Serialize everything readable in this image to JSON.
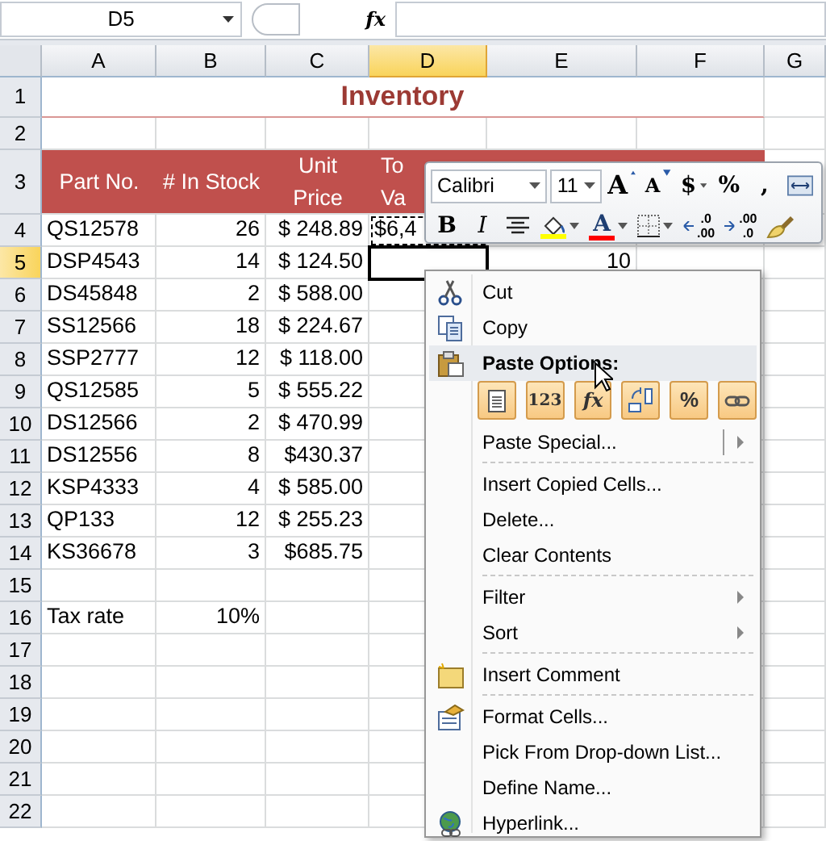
{
  "name_box": {
    "value": "D5"
  },
  "formula_bar": {
    "fx_label": "fx"
  },
  "columns": [
    {
      "label": "A",
      "selected": false
    },
    {
      "label": "B",
      "selected": false
    },
    {
      "label": "C",
      "selected": false
    },
    {
      "label": "D",
      "selected": true
    },
    {
      "label": "E",
      "selected": false
    },
    {
      "label": "F",
      "selected": false
    },
    {
      "label": "G",
      "selected": false
    }
  ],
  "rows": [
    {
      "number": "1",
      "selected": false,
      "kind": "title",
      "title": "Inventory"
    },
    {
      "number": "2",
      "selected": false,
      "kind": "blank"
    },
    {
      "number": "3",
      "selected": false,
      "kind": "header",
      "headers": [
        {
          "kind": "full",
          "lines": [
            "Part No."
          ]
        },
        {
          "kind": "full",
          "lines": [
            "# In Stock"
          ]
        },
        {
          "kind": "full",
          "lines": [
            "Unit",
            "Price"
          ]
        },
        {
          "kind": "clipped",
          "lines": [
            "To",
            "Va"
          ]
        }
      ]
    },
    {
      "number": "4",
      "selected": false,
      "kind": "data",
      "cells": [
        {
          "text": "QS12578"
        },
        {
          "text": "26"
        },
        {
          "text": "$ 248.89"
        },
        {
          "kind": "clipped",
          "text": "$6,4",
          "copied": true
        },
        null,
        null,
        null
      ]
    },
    {
      "number": "5",
      "selected": true,
      "kind": "data",
      "cells": [
        {
          "text": "DSP4543"
        },
        {
          "text": "14"
        },
        {
          "text": "$ 124.50"
        },
        {
          "active": true
        },
        {
          "text": "10"
        },
        null,
        null
      ]
    },
    {
      "number": "6",
      "selected": false,
      "kind": "data",
      "cells": [
        {
          "text": "DS45848"
        },
        {
          "text": "2"
        },
        {
          "text": "$ 588.00"
        },
        null,
        null,
        null,
        null
      ]
    },
    {
      "number": "7",
      "selected": false,
      "kind": "data",
      "cells": [
        {
          "text": "SS12566"
        },
        {
          "text": "18"
        },
        {
          "text": "$ 224.67"
        },
        null,
        null,
        null,
        null
      ]
    },
    {
      "number": "8",
      "selected": false,
      "kind": "data",
      "cells": [
        {
          "text": "SSP2777"
        },
        {
          "text": "12"
        },
        {
          "text": "$ 118.00"
        },
        null,
        null,
        null,
        null
      ]
    },
    {
      "number": "9",
      "selected": false,
      "kind": "data",
      "cells": [
        {
          "text": "QS12585"
        },
        {
          "text": "5"
        },
        {
          "text": "$ 555.22"
        },
        null,
        null,
        null,
        null
      ]
    },
    {
      "number": "10",
      "selected": false,
      "kind": "data",
      "cells": [
        {
          "text": "DS12566"
        },
        {
          "text": "2"
        },
        {
          "text": "$ 470.99"
        },
        null,
        null,
        null,
        null
      ]
    },
    {
      "number": "11",
      "selected": false,
      "kind": "data",
      "cells": [
        {
          "text": "DS12556"
        },
        {
          "text": "8"
        },
        {
          "text": "$430.37"
        },
        null,
        null,
        null,
        null
      ]
    },
    {
      "number": "12",
      "selected": false,
      "kind": "data",
      "cells": [
        {
          "text": "KSP4333"
        },
        {
          "text": "4"
        },
        {
          "text": "$ 585.00"
        },
        null,
        null,
        null,
        null
      ]
    },
    {
      "number": "13",
      "selected": false,
      "kind": "data",
      "cells": [
        {
          "text": "QP133"
        },
        {
          "text": "12"
        },
        {
          "text": "$ 255.23"
        },
        null,
        null,
        null,
        null
      ]
    },
    {
      "number": "14",
      "selected": false,
      "kind": "data",
      "cells": [
        {
          "text": "KS36678"
        },
        {
          "text": "3"
        },
        {
          "text": "$685.75"
        },
        null,
        null,
        null,
        null
      ]
    },
    {
      "number": "15",
      "selected": false,
      "kind": "blank"
    },
    {
      "number": "16",
      "selected": false,
      "kind": "data",
      "cells": [
        {
          "text": "Tax rate"
        },
        {
          "text": "10%"
        },
        null,
        null,
        null,
        null,
        null
      ]
    },
    {
      "number": "17",
      "selected": false,
      "kind": "blank"
    },
    {
      "number": "18",
      "selected": false,
      "kind": "blank"
    },
    {
      "number": "19",
      "selected": false,
      "kind": "blank"
    },
    {
      "number": "20",
      "selected": false,
      "kind": "blank"
    },
    {
      "number": "21",
      "selected": false,
      "kind": "blank"
    },
    {
      "number": "22",
      "selected": false,
      "kind": "blank"
    }
  ],
  "mini_toolbar": {
    "font": {
      "value": "Calibri"
    },
    "size": {
      "value": "11"
    },
    "row1": [
      {
        "kind": "grow-font",
        "text": "A"
      },
      {
        "kind": "shrink-font",
        "text": "A"
      },
      {
        "kind": "glyph",
        "text": "$",
        "dropdown": true
      },
      {
        "kind": "glyph",
        "text": "%",
        "dropdown": false
      },
      {
        "kind": "glyph",
        "text": ",",
        "dropdown": false
      },
      {
        "kind": "merge"
      }
    ],
    "row2": [
      {
        "kind": "bold",
        "text": "B"
      },
      {
        "kind": "italic",
        "text": "I"
      },
      {
        "kind": "center"
      },
      {
        "kind": "fill-color",
        "color": "#ffff00",
        "dropdown": true
      },
      {
        "kind": "font-color",
        "text": "A",
        "color": "#ff0000",
        "dropdown": true
      },
      {
        "kind": "borders",
        "dropdown": true
      },
      {
        "kind": "increase-decimal",
        "top": ".0",
        "bottom": ".00"
      },
      {
        "kind": "decrease-decimal",
        "top": ".00",
        "bottom": ".0"
      },
      {
        "kind": "format-painter"
      }
    ]
  },
  "context_menu": [
    {
      "kind": "cut",
      "label": "Cut",
      "highlighted": false
    },
    {
      "kind": "copy",
      "label": "Copy",
      "highlighted": false
    },
    {
      "kind": "paste-header",
      "label": "Paste Options:",
      "highlighted": true
    },
    {
      "kind": "paste-options",
      "options": [
        {
          "kind": "document"
        },
        {
          "kind": "text",
          "text": "123"
        },
        {
          "kind": "formula",
          "text": "fx"
        },
        {
          "kind": "transpose"
        },
        {
          "kind": "formatting",
          "text": "%"
        },
        {
          "kind": "link"
        }
      ]
    },
    {
      "kind": "split-submenu",
      "label": "Paste Special...",
      "highlighted": false
    },
    {
      "kind": "separator"
    },
    {
      "kind": "plain",
      "label": "Insert Copied Cells...",
      "highlighted": false
    },
    {
      "kind": "plain",
      "label": "Delete...",
      "highlighted": false
    },
    {
      "kind": "plain",
      "label": "Clear Contents",
      "highlighted": false
    },
    {
      "kind": "separator"
    },
    {
      "kind": "submenu",
      "label": "Filter",
      "highlighted": false
    },
    {
      "kind": "submenu",
      "label": "Sort",
      "highlighted": false
    },
    {
      "kind": "separator"
    },
    {
      "kind": "comment",
      "label": "Insert Comment",
      "highlighted": false
    },
    {
      "kind": "separator"
    },
    {
      "kind": "format-cells",
      "label": "Format Cells...",
      "highlighted": false
    },
    {
      "kind": "plain",
      "label": "Pick From Drop-down List...",
      "highlighted": false
    },
    {
      "kind": "plain",
      "label": "Define Name...",
      "highlighted": false
    },
    {
      "kind": "hyperlink",
      "label": "Hyperlink...",
      "highlighted": false
    }
  ]
}
